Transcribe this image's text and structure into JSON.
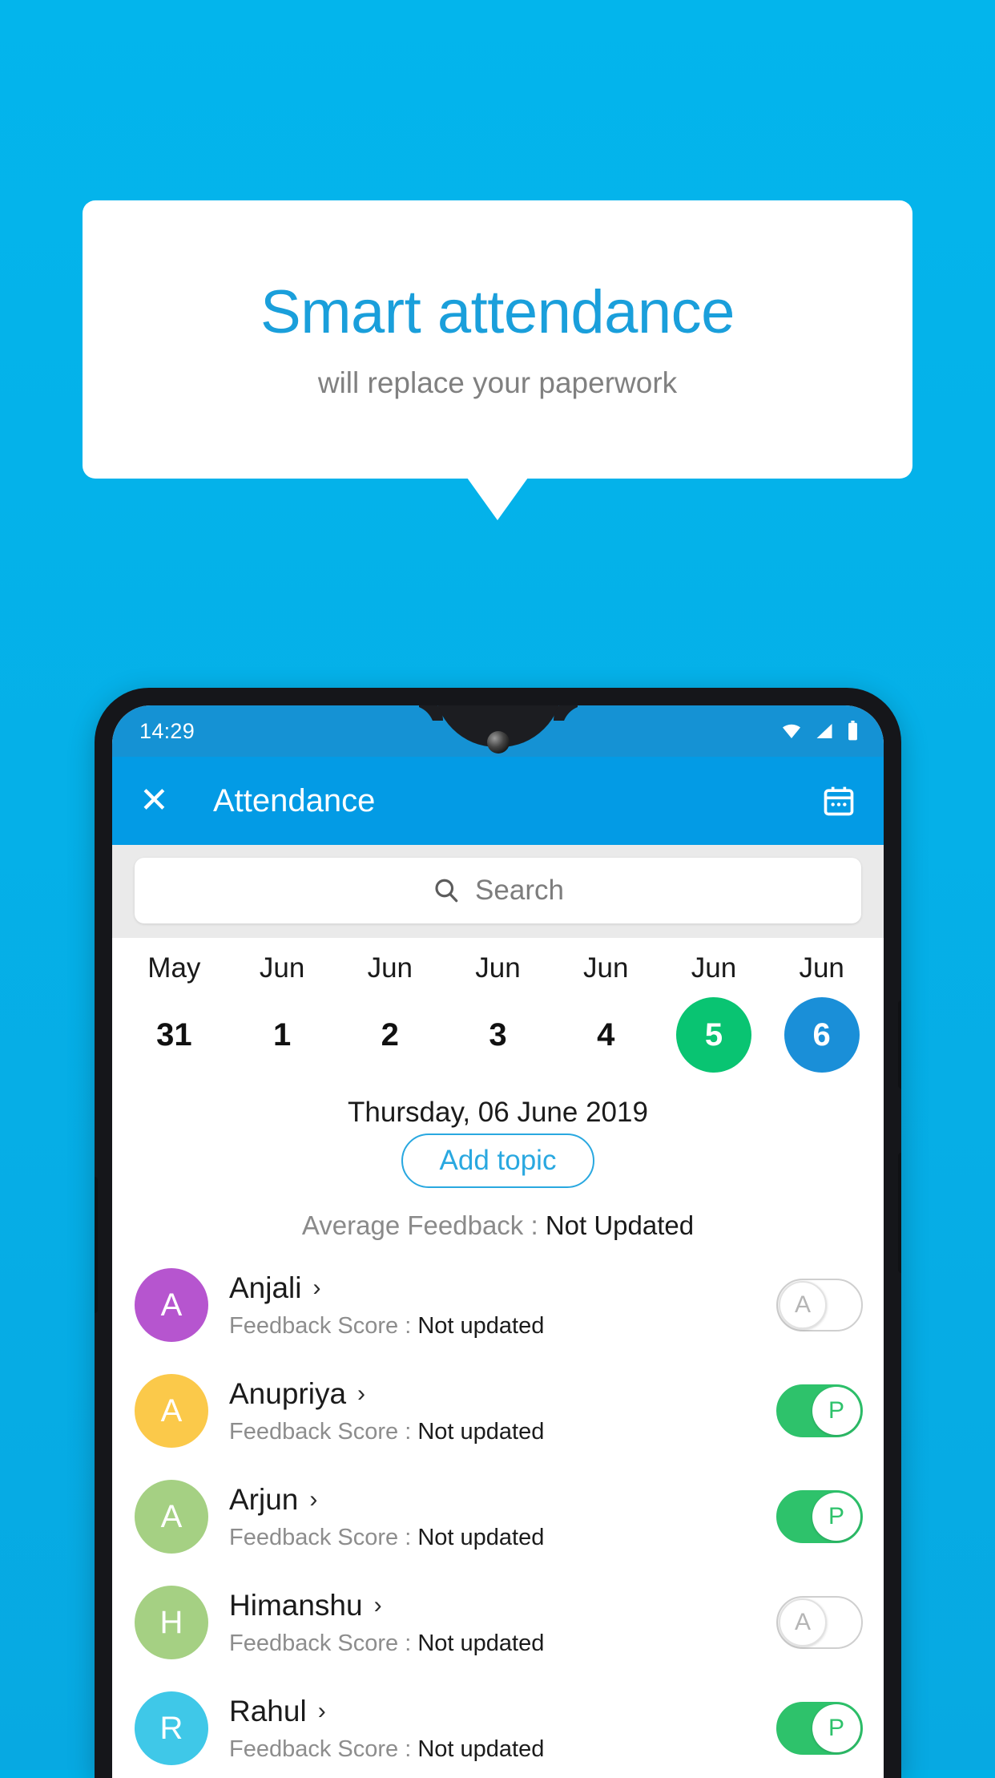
{
  "promo": {
    "title": "Smart attendance",
    "subtitle": "will replace your paperwork",
    "title_color": "#1a9fdb",
    "background_color": "#03b5ec"
  },
  "phone": {
    "statusbar": {
      "time": "14:29",
      "icons": [
        "wifi-icon",
        "signal-icon",
        "battery-icon"
      ]
    },
    "appbar": {
      "close_label": "✕",
      "title": "Attendance",
      "action_icon": "calendar-icon",
      "color": "#039be5"
    },
    "search": {
      "placeholder": "Search",
      "icon": "search-icon"
    },
    "date_strip": [
      {
        "month": "May",
        "day": "31",
        "state": "normal"
      },
      {
        "month": "Jun",
        "day": "1",
        "state": "normal"
      },
      {
        "month": "Jun",
        "day": "2",
        "state": "normal"
      },
      {
        "month": "Jun",
        "day": "3",
        "state": "normal"
      },
      {
        "month": "Jun",
        "day": "4",
        "state": "normal"
      },
      {
        "month": "Jun",
        "day": "5",
        "state": "today"
      },
      {
        "month": "Jun",
        "day": "6",
        "state": "selected"
      }
    ],
    "selected_date": "Thursday, 06 June 2019",
    "add_topic_label": "Add topic",
    "average_feedback": {
      "label": "Average Feedback : ",
      "value": "Not Updated"
    },
    "feedback_label": "Feedback Score : ",
    "students": [
      {
        "name": "Anjali",
        "initial": "A",
        "avatar_color": "#b655cf",
        "feedback": "Not updated",
        "attendance": "A",
        "attendance_state": "absent"
      },
      {
        "name": "Anupriya",
        "initial": "A",
        "avatar_color": "#fbc94a",
        "feedback": "Not updated",
        "attendance": "P",
        "attendance_state": "present"
      },
      {
        "name": "Arjun",
        "initial": "A",
        "avatar_color": "#a5d083",
        "feedback": "Not updated",
        "attendance": "P",
        "attendance_state": "present"
      },
      {
        "name": "Himanshu",
        "initial": "H",
        "avatar_color": "#a5d083",
        "feedback": "Not updated",
        "attendance": "A",
        "attendance_state": "absent"
      },
      {
        "name": "Rahul",
        "initial": "R",
        "avatar_color": "#3fc8e8",
        "feedback": "Not updated",
        "attendance": "P",
        "attendance_state": "present"
      }
    ],
    "colors": {
      "today_green": "#09c472",
      "selected_blue": "#1a8fd8",
      "present_green": "#2ec26b",
      "accent": "#29a8e0"
    }
  }
}
